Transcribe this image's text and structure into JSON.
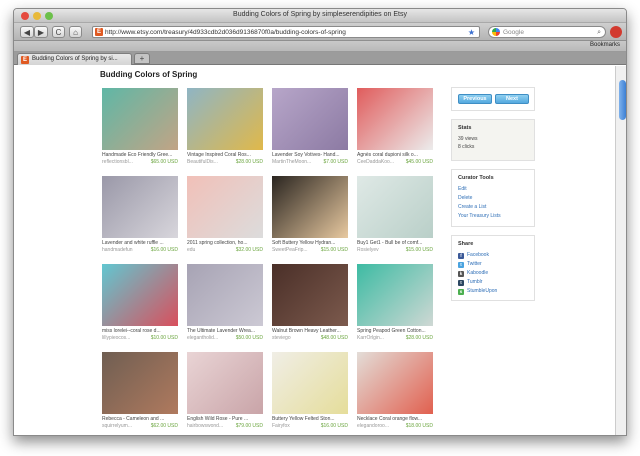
{
  "window": {
    "title": "Budding Colors of Spring by simpleserendipities on Etsy"
  },
  "browser": {
    "url": "http://www.etsy.com/treasury/4d933cdb2d036d9136870f0a/budding-colors-of-spring",
    "search_placeholder": "Google",
    "bookmarks_label": "Bookmarks",
    "tab_label": "Budding Colors of Spring by si...",
    "new_tab": "+",
    "back": "◀",
    "forward": "▶",
    "reload": "C",
    "home": "⌂",
    "favicon": "E"
  },
  "page": {
    "title": "Budding Colors of Spring",
    "items": [
      {
        "name": "Handmade Eco Friendly Gree...",
        "shop": "reflectionsbl...",
        "price": "$65.00 USD",
        "colors": [
          "#5fb7a6",
          "#c2a485"
        ]
      },
      {
        "name": "Vintage Inspired Coral Ros...",
        "shop": "BeautifulDis...",
        "price": "$28.00 USD",
        "colors": [
          "#8fb5c4",
          "#e0b84a"
        ]
      },
      {
        "name": "Lavender Soy Votives- Hand...",
        "shop": "MartinTheMoon...",
        "price": "$7.00 USD",
        "colors": [
          "#b7a6c9",
          "#8c7aa3"
        ]
      },
      {
        "name": "Agnès coral dupioni silk o...",
        "shop": "CeeDaddaKoo...",
        "price": "$45.00 USD",
        "colors": [
          "#e05c5c",
          "#ececec"
        ]
      },
      {
        "name": "Lavender and white ruffle ...",
        "shop": "handmadefun",
        "price": "$16.00 USD",
        "colors": [
          "#9a98a8",
          "#d8d6dc"
        ]
      },
      {
        "name": "2011 spring collection, ho...",
        "shop": "edu",
        "price": "$32.00 USD",
        "colors": [
          "#f1c0b8",
          "#dcdcdc"
        ]
      },
      {
        "name": "Soft Buttery Yellow Hydran...",
        "shop": "SweetPeaFrip...",
        "price": "$15.00 USD",
        "colors": [
          "#2a2520",
          "#e8c9a0"
        ]
      },
      {
        "name": "Buy1 Get1 - Bull be of comf...",
        "shop": "Rosielyev",
        "price": "$15.00 USD",
        "colors": [
          "#dfe9e6",
          "#b9cfc8"
        ]
      },
      {
        "name": "miss lorelei--coral rose d...",
        "shop": "lillypieocos...",
        "price": "$10.00 USD",
        "colors": [
          "#61c7d1",
          "#d94f5c"
        ]
      },
      {
        "name": "The Ultimate Lavender Wrea...",
        "shop": "elegantholid...",
        "price": "$50.00 USD",
        "colors": [
          "#a7a3b4",
          "#ccc9d4"
        ]
      },
      {
        "name": "Walnut Brown Heavy Leather...",
        "shop": "steviego",
        "price": "$48.00 USD",
        "colors": [
          "#4a2f28",
          "#7c5a4d"
        ]
      },
      {
        "name": "Spring Peapod Green Cotton...",
        "shop": "KarrOrlgin...",
        "price": "$28.00 USD",
        "colors": [
          "#3dbba3",
          "#cfd8d4"
        ]
      },
      {
        "name": "Rebecca - Cameleon and ...",
        "shop": "squirrelyum...",
        "price": "$62.00 USD",
        "colors": [
          "#6f5e52",
          "#b07a5e"
        ]
      },
      {
        "name": "English Wild Rose - Pure ...",
        "shop": "hairbowswond...",
        "price": "$79.00 USD",
        "colors": [
          "#e9d4d5",
          "#c9a4a8"
        ]
      },
      {
        "name": "Buttery Yellow Felted Ston...",
        "shop": "Fairyfox",
        "price": "$16.00 USD",
        "colors": [
          "#f0eee6",
          "#e5dd9a"
        ]
      },
      {
        "name": "Necklace Coral orange flow...",
        "shop": "elegandoroo...",
        "price": "$18.00 USD",
        "colors": [
          "#e3ddd8",
          "#e1604f"
        ]
      }
    ],
    "nav": {
      "previous": "Previous",
      "next": "Next"
    },
    "stats": {
      "heading": "Stats",
      "views": "39 views",
      "clicks": "8 clicks"
    },
    "curator": {
      "heading": "Curator Tools",
      "links": [
        "Edit",
        "Delete",
        "Create a List",
        "Your Treasury Lists"
      ]
    },
    "share": {
      "heading": "Share",
      "links": [
        {
          "label": "Facebook",
          "icon": "facebook-icon",
          "color": "#3b5998",
          "glyph": "f"
        },
        {
          "label": "Twitter",
          "icon": "twitter-icon",
          "color": "#4aa3df",
          "glyph": "t"
        },
        {
          "label": "Kaboodle",
          "icon": "kaboodle-icon",
          "color": "#555555",
          "glyph": "k"
        },
        {
          "label": "Tumblr",
          "icon": "tumblr-icon",
          "color": "#2c4762",
          "glyph": "t"
        },
        {
          "label": "StumbleUpon",
          "icon": "stumbleupon-icon",
          "color": "#4caf50",
          "glyph": "s"
        }
      ]
    }
  }
}
